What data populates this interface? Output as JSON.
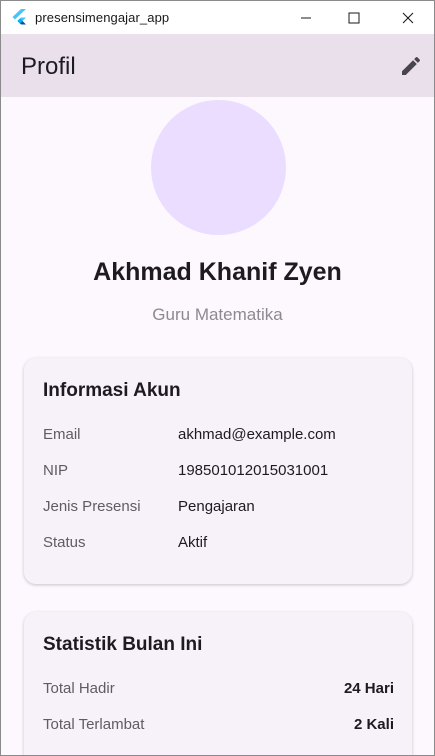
{
  "window": {
    "title": "presensimengajar_app"
  },
  "appbar": {
    "title": "Profil"
  },
  "profile": {
    "name": "Akhmad Khanif Zyen",
    "role": "Guru Matematika"
  },
  "account_card": {
    "title": "Informasi Akun",
    "rows": [
      {
        "label": "Email",
        "value": "akhmad@example.com"
      },
      {
        "label": "NIP",
        "value": "198501012015031001"
      },
      {
        "label": "Jenis Presensi",
        "value": "Pengajaran"
      },
      {
        "label": "Status",
        "value": "Aktif"
      }
    ]
  },
  "stats_card": {
    "title": "Statistik Bulan Ini",
    "rows": [
      {
        "label": "Total Hadir",
        "value": "24 Hari"
      },
      {
        "label": "Total Terlambat",
        "value": "2 Kali"
      }
    ]
  },
  "icons": {
    "app": "flutter-logo-icon",
    "minimize": "minimize-icon",
    "maximize": "maximize-icon",
    "close": "close-icon",
    "edit": "edit-pencil-icon"
  },
  "colors": {
    "appbar_bg": "#e9e0ec",
    "page_bg": "#fdf7fe",
    "avatar_bg": "#eaddff",
    "card_bg": "#f7f1f9"
  }
}
